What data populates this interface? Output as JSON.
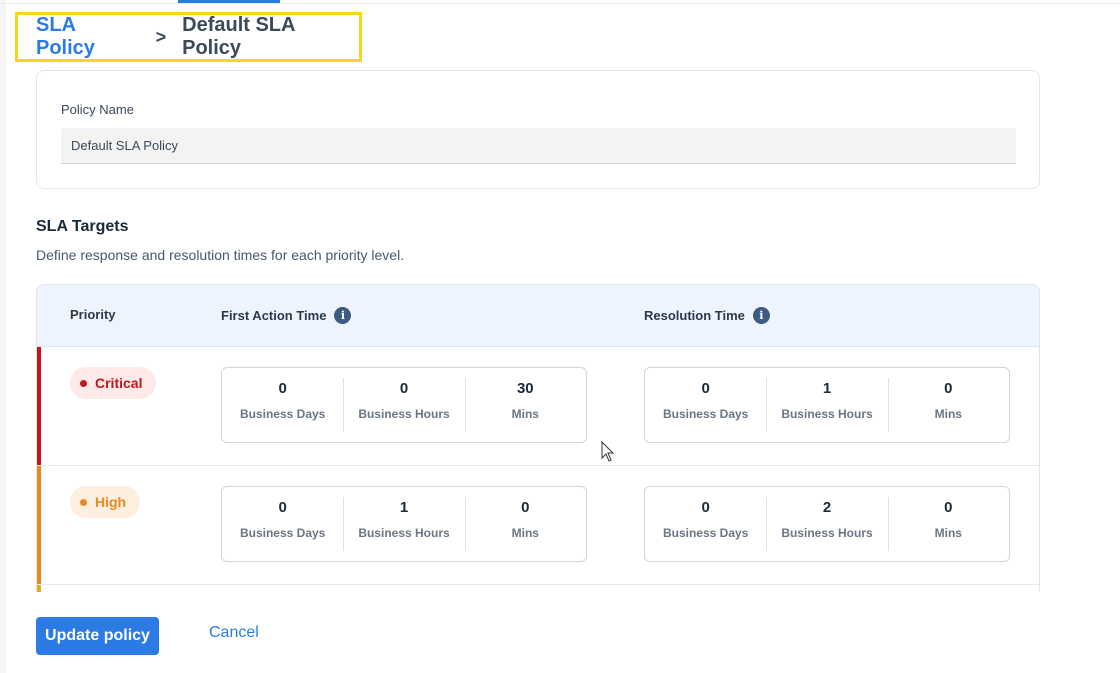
{
  "breadcrumb": {
    "parent": "SLA Policy",
    "separator": ">",
    "current": "Default SLA Policy"
  },
  "policy": {
    "name_label": "Policy Name",
    "name_value": "Default SLA Policy"
  },
  "targets": {
    "title": "SLA Targets",
    "description": "Define response and resolution times for each priority level.",
    "columns": {
      "priority": "Priority",
      "first_action": "First Action Time",
      "resolution": "Resolution Time"
    },
    "info_icon_glyph": "i",
    "unit_labels": [
      "Business Days",
      "Business Hours",
      "Mins"
    ],
    "rows": [
      {
        "priority": "Critical",
        "color": "#c0171c",
        "pill_bg": "#fde9e8",
        "first_action": [
          "0",
          "0",
          "30"
        ],
        "resolution": [
          "0",
          "1",
          "0"
        ]
      },
      {
        "priority": "High",
        "color": "#e8891d",
        "pill_bg": "#fdefe0",
        "first_action": [
          "0",
          "1",
          "0"
        ],
        "resolution": [
          "0",
          "2",
          "0"
        ]
      }
    ]
  },
  "actions": {
    "update_label": "Update policy",
    "cancel_label": "Cancel"
  },
  "colors": {
    "accent": "#2c7be5",
    "highlight_border": "#f7d61b"
  }
}
